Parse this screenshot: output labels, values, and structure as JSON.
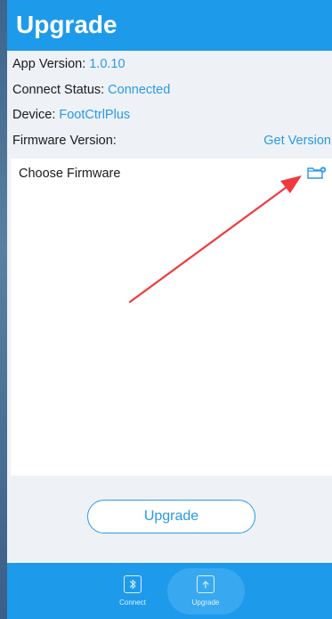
{
  "header": {
    "title": "Upgrade"
  },
  "info": {
    "app_version_label": "App Version:",
    "app_version_value": "1.0.10",
    "connect_status_label": "Connect Status:",
    "connect_status_value": "Connected",
    "device_label": "Device:",
    "device_value": "FootCtrlPlus",
    "firmware_version_label": "Firmware Version:",
    "get_version_link": "Get Version"
  },
  "firmware_panel": {
    "label": "Choose Firmware",
    "folder_icon": "folder-plus-icon"
  },
  "actions": {
    "upgrade_label": "Upgrade"
  },
  "tabbar": {
    "tabs": [
      {
        "label": "Connect",
        "icon": "bluetooth-icon",
        "active": false
      },
      {
        "label": "Upgrade",
        "icon": "upgrade-icon",
        "active": true
      }
    ]
  },
  "colors": {
    "accent": "#1e9aea",
    "link": "#2a9ae6",
    "annotation_arrow": "#f0393f"
  }
}
